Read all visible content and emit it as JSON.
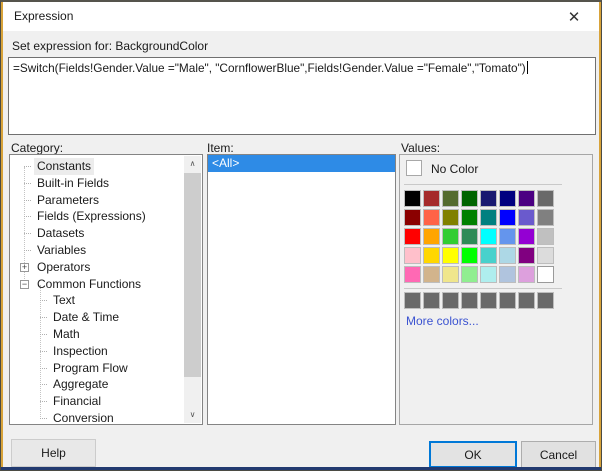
{
  "dialog": {
    "title": "Expression",
    "close_icon": "✕"
  },
  "expression": {
    "label": "Set expression for: BackgroundColor",
    "value": "=Switch(Fields!Gender.Value =\"Male\", \"CornflowerBlue\",Fields!Gender.Value =\"Female\",\"Tomato\")"
  },
  "category": {
    "label": "Category:",
    "items": [
      {
        "label": "Constants",
        "level": 0,
        "glyph": null,
        "selected": true
      },
      {
        "label": "Built-in Fields",
        "level": 0,
        "glyph": null
      },
      {
        "label": "Parameters",
        "level": 0,
        "glyph": null
      },
      {
        "label": "Fields (Expressions)",
        "level": 0,
        "glyph": null
      },
      {
        "label": "Datasets",
        "level": 0,
        "glyph": null
      },
      {
        "label": "Variables",
        "level": 0,
        "glyph": null
      },
      {
        "label": "Operators",
        "level": 0,
        "glyph": "expand"
      },
      {
        "label": "Common Functions",
        "level": 0,
        "glyph": "collapse"
      },
      {
        "label": "Text",
        "level": 1,
        "glyph": null
      },
      {
        "label": "Date & Time",
        "level": 1,
        "glyph": null
      },
      {
        "label": "Math",
        "level": 1,
        "glyph": null
      },
      {
        "label": "Inspection",
        "level": 1,
        "glyph": null
      },
      {
        "label": "Program Flow",
        "level": 1,
        "glyph": null
      },
      {
        "label": "Aggregate",
        "level": 1,
        "glyph": null
      },
      {
        "label": "Financial",
        "level": 1,
        "glyph": null
      },
      {
        "label": "Conversion",
        "level": 1,
        "glyph": null
      }
    ]
  },
  "item": {
    "label": "Item:",
    "rows": [
      {
        "label": "<All>",
        "selected": true
      }
    ]
  },
  "values": {
    "label": "Values:",
    "no_color_label": "No Color",
    "more_colors_label": "More colors...",
    "palette": [
      [
        "#000000",
        "#A52A2A",
        "#556B2F",
        "#006400",
        "#191970",
        "#000080",
        "#4B0082",
        "#696969"
      ],
      [
        "#8B0000",
        "#FF6347",
        "#808000",
        "#008000",
        "#008080",
        "#0000FF",
        "#6A5ACD",
        "#808080"
      ],
      [
        "#FF0000",
        "#FFA500",
        "#32CD32",
        "#2E8B57",
        "#00FFFF",
        "#6495ED",
        "#9400D3",
        "#C0C0C0"
      ],
      [
        "#FFC0CB",
        "#FFD700",
        "#FFFF00",
        "#00FF00",
        "#48D1CC",
        "#ADD8E6",
        "#800080",
        "#DCDCDC"
      ],
      [
        "#FF69B4",
        "#D2B48C",
        "#F0E68C",
        "#90EE90",
        "#AFEEEE",
        "#B0C4DE",
        "#DDA0DD",
        "#FFFFFF"
      ]
    ],
    "custom_row": [
      "#696969",
      "#696969",
      "#696969",
      "#696969",
      "#696969",
      "#696969",
      "#696969",
      "#696969"
    ]
  },
  "buttons": {
    "help": "Help",
    "ok": "OK",
    "cancel": "Cancel"
  },
  "icons": {
    "scroll_up": "∧",
    "scroll_down": "∨",
    "expand": "+",
    "collapse": "−"
  },
  "colors": {
    "selection": "#2E8BE6",
    "link": "#3B53D1",
    "ok_border": "#0078D7",
    "accent_edge": "#D8A33A",
    "bottom_edge": "#223A70",
    "dialog_bg": "#F0F0F0"
  }
}
